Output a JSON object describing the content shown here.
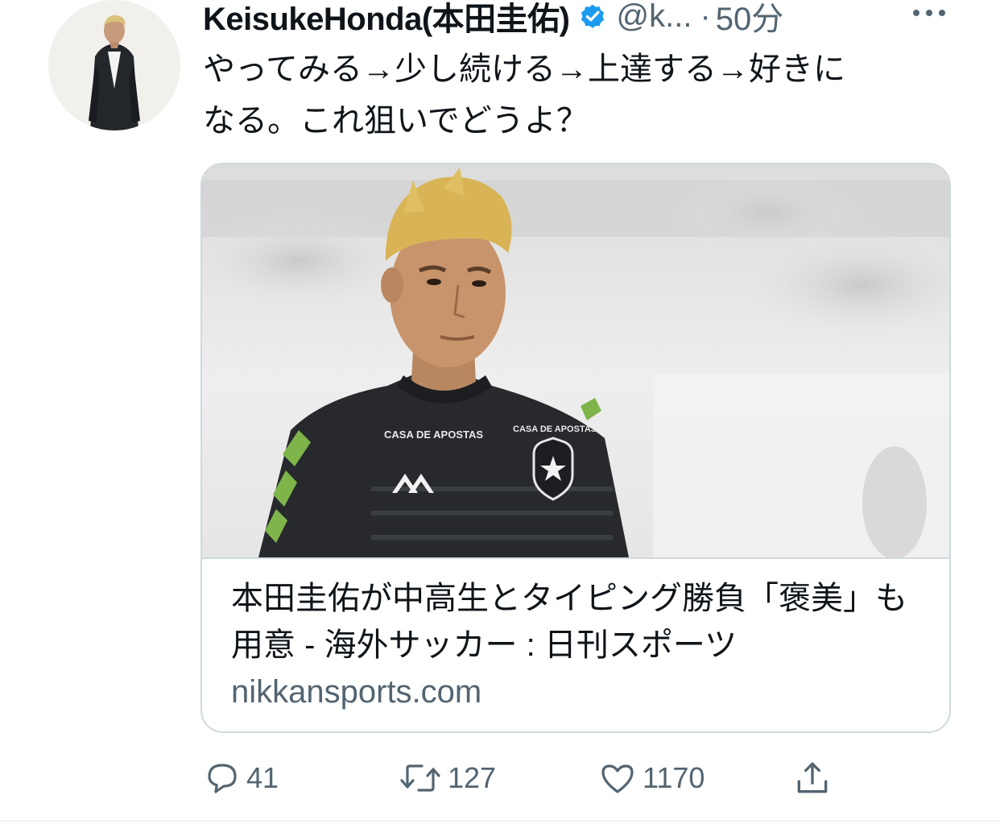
{
  "tweet": {
    "display_name": "KeisukeHonda(本田圭佑)",
    "handle": "@k...",
    "separator": "·",
    "time": "50分",
    "text": "やってみる→少し続ける→上達する→好きに\nなる。これ狙いでどうよ？",
    "verified_color": "#1d9bf0"
  },
  "card": {
    "title": "本田圭佑が中高生とタイピング勝負「褒美」も用意 - 海外サッカー : 日刊スポーツ",
    "domain": "nikkansports.com",
    "image": {
      "jersey_text_left": "CASA DE APOSTAS",
      "jersey_text_right": "CASA DE APOSTAS"
    }
  },
  "actions": {
    "reply_count": "41",
    "retweet_count": "127",
    "like_count": "1170"
  },
  "icons": [
    "verified-badge-icon",
    "more-icon",
    "reply-icon",
    "retweet-icon",
    "like-icon",
    "share-icon"
  ],
  "colors": {
    "text": "#0f1419",
    "secondary": "#536471",
    "border": "#cfd9de"
  }
}
